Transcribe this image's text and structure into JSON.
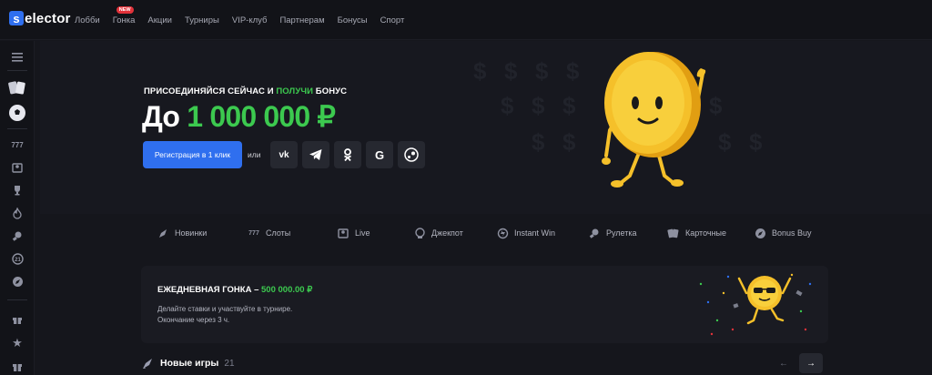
{
  "logo": {
    "letter": "s",
    "text": "elector"
  },
  "nav": [
    {
      "label": "Лобби"
    },
    {
      "label": "Гонка",
      "badge": "NEW"
    },
    {
      "label": "Акции"
    },
    {
      "label": "Турниры"
    },
    {
      "label": "VIP-клуб"
    },
    {
      "label": "Партнерам"
    },
    {
      "label": "Бонусы"
    },
    {
      "label": "Спорт"
    }
  ],
  "sidebar": {
    "icons": [
      "menu-icon",
      "cards-icon",
      "soccer-ball-icon",
      "slots-777-icon",
      "live-dealer-icon",
      "trophy-icon",
      "fire-icon",
      "roulette-icon",
      "crash-icon",
      "rocket-icon",
      "gift-icon",
      "star-icon",
      "present-icon"
    ]
  },
  "hero": {
    "kicker_a": "ПРИСОЕДИНЯЙСЯ СЕЙЧАС И ",
    "kicker_hl": "ПОЛУЧИ",
    "kicker_b": " БОНУС",
    "amount_prefix": "До",
    "amount_value": "1 000 000 ₽",
    "register_label": "Регистрация в 1 клик",
    "or_label": "или",
    "socials": [
      "vk-icon",
      "telegram-icon",
      "odnoklassniki-icon",
      "google-icon",
      "steam-icon"
    ]
  },
  "categories": [
    {
      "label": "Новинки",
      "icon": "rocket-icon"
    },
    {
      "label": "Слоты",
      "icon": "slots-777-icon"
    },
    {
      "label": "Live",
      "icon": "live-dealer-icon"
    },
    {
      "label": "Джекпот",
      "icon": "jackpot-icon"
    },
    {
      "label": "Instant Win",
      "icon": "instant-win-icon"
    },
    {
      "label": "Рулетка",
      "icon": "roulette-icon"
    },
    {
      "label": "Карточные",
      "icon": "cards-icon"
    },
    {
      "label": "Bonus Buy",
      "icon": "bonus-buy-icon"
    }
  ],
  "race": {
    "title": "ЕЖЕДНЕВНАЯ ГОНКА – ",
    "prize": "500 000.00 ₽",
    "desc_line1": "Делайте ставки и участвуйте в турнире.",
    "desc_line2": "Окончание через 3 ч."
  },
  "new_games": {
    "title": "Новые игры",
    "count": "21"
  },
  "colors": {
    "accent_blue": "#2f6fef",
    "accent_green": "#3cc94f",
    "coin": "#f5c02a",
    "background": "#15161c"
  }
}
